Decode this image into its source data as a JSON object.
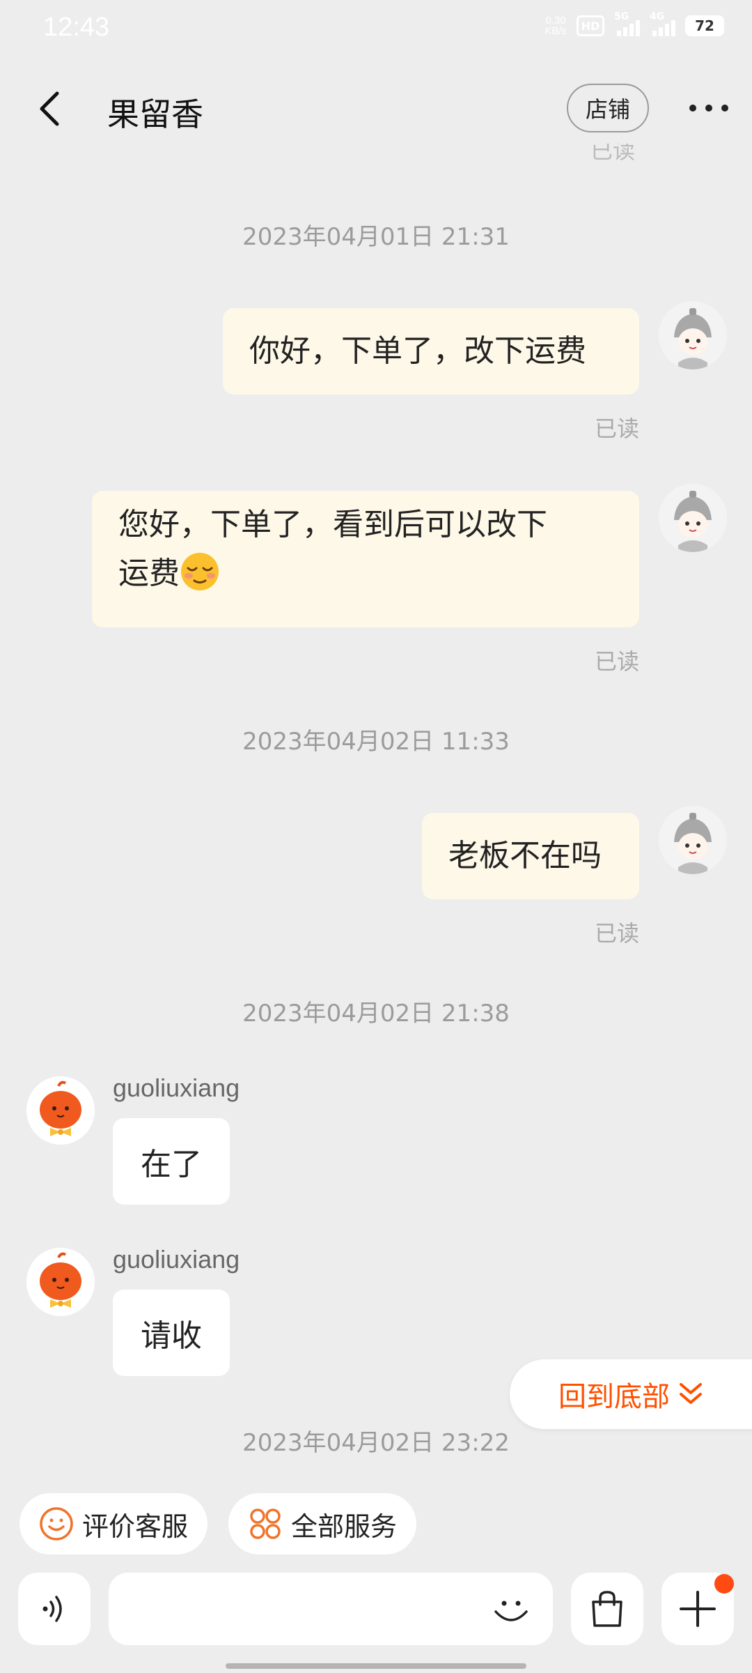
{
  "status_bar": {
    "time": "12:43",
    "net_speed_value": "0.30",
    "net_speed_unit": "KB/s",
    "hd_label": "HD",
    "signal1_label": "5G",
    "signal2_label": "4G",
    "battery": "72"
  },
  "header": {
    "title": "果留香",
    "shop_button": "店铺"
  },
  "partial_read_label": "已读",
  "messages": [
    {
      "type": "timestamp",
      "text": "2023年04月01日 21:31"
    },
    {
      "type": "outgoing",
      "text": "你好，下单了，改下运费",
      "status": "已读"
    },
    {
      "type": "outgoing",
      "text_line1": "您好，下单了，看到后可以改下",
      "text_line2": "运费",
      "emoji": "relieved-face",
      "status": "已读"
    },
    {
      "type": "timestamp",
      "text": "2023年04月02日 11:33"
    },
    {
      "type": "outgoing",
      "text": "老板不在吗",
      "status": "已读"
    },
    {
      "type": "timestamp",
      "text": "2023年04月02日 21:38"
    },
    {
      "type": "incoming",
      "sender": "guoliuxiang",
      "text": "在了"
    },
    {
      "type": "incoming",
      "sender": "guoliuxiang",
      "text": "请收"
    },
    {
      "type": "timestamp",
      "text": "2023年04月02日 23:22"
    }
  ],
  "back_to_bottom": "回到底部",
  "quick_actions": [
    {
      "label": "评价客服",
      "icon": "smiley-icon"
    },
    {
      "label": "全部服务",
      "icon": "grid-services-icon"
    }
  ],
  "input": {
    "value": "",
    "placeholder": ""
  },
  "colors": {
    "accent": "#ff5000",
    "outgoing_bubble": "#fef8e8",
    "incoming_bubble": "#ffffff",
    "background": "#ededed"
  }
}
